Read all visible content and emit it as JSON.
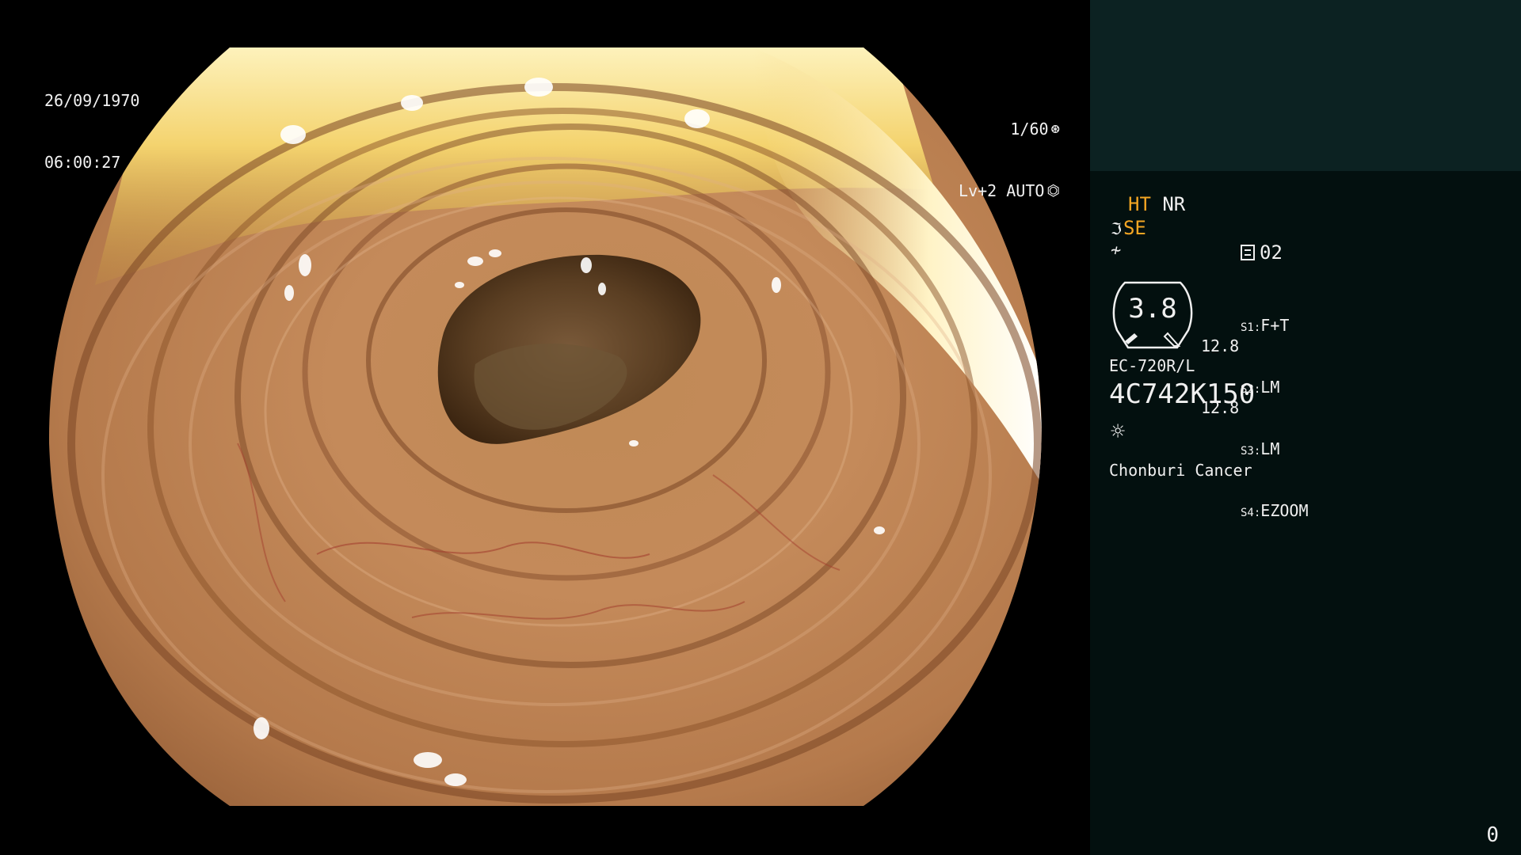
{
  "overlay": {
    "date": "26/09/1970",
    "time": "06:00:27",
    "shutter": "1/60",
    "shutter_icon": "aperture-icon",
    "iris_mode": "Lv+2 AUTO",
    "iris_icon": "iris-icon"
  },
  "panel": {
    "ht_label": "HT",
    "nr_label": "NR",
    "se_label": "SE",
    "se_icon": "structure-enhance-icon",
    "freeze_icon": "freeze-icon",
    "memo_icon": "memory-card-icon",
    "memo_value": "02",
    "scope_value": "3.8",
    "pressures": [
      "12.8",
      "12.8"
    ],
    "switches": [
      {
        "key": "S1:",
        "value": "F+T"
      },
      {
        "key": "S2:",
        "value": "LM"
      },
      {
        "key": "S3:",
        "value": "LM"
      },
      {
        "key": "S4:",
        "value": "EZOOM"
      }
    ],
    "scope_model": "EC-720R/L",
    "serial": "4C742K150",
    "light_icon": "light-source-icon",
    "hospital": "Chonburi Cancer",
    "counter": "0"
  },
  "colors": {
    "panel_bg": "#03100f",
    "panel_top_bg": "#0c2222",
    "accent_orange": "#f5a623",
    "text": "#f0f0f0"
  }
}
